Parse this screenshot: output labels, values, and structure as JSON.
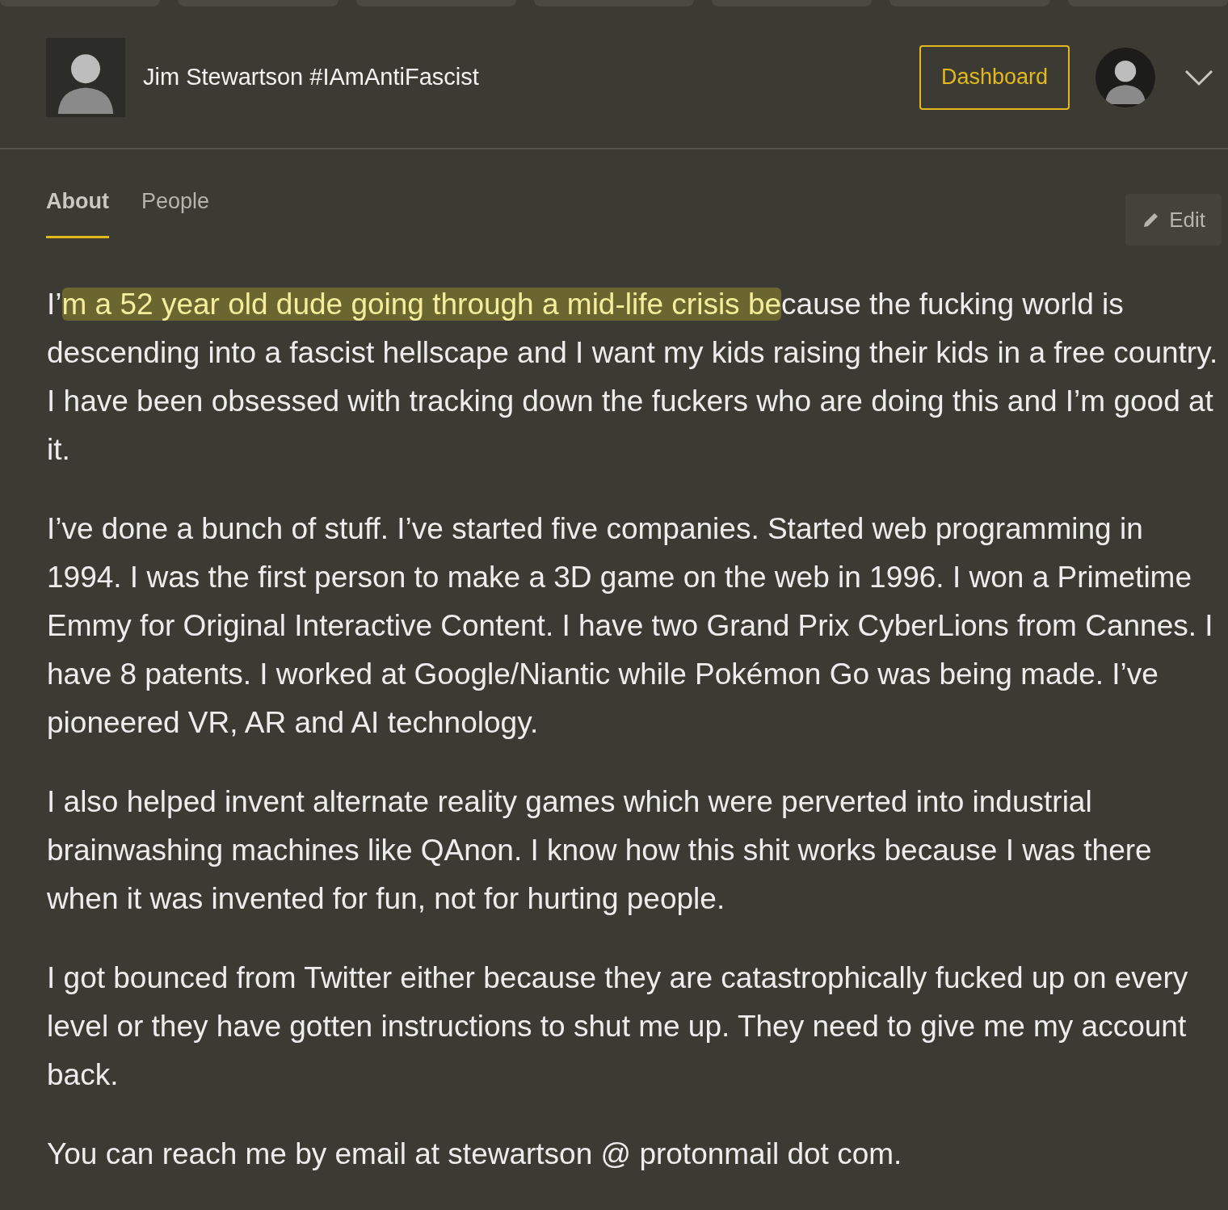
{
  "header": {
    "name": "Jim Stewartson #IAmAntiFascist",
    "button": "Dashboard"
  },
  "tabs": [
    {
      "label": "About",
      "selected": true
    },
    {
      "label": "People",
      "selected": false
    }
  ],
  "edit_button": "Edit",
  "paragraphs": [
    {
      "segments": [
        {
          "text": "I’",
          "highlighted": false
        },
        {
          "text": "m a 52 year old dude going through a mid-life crisis be",
          "highlighted": true
        },
        {
          "text": "cause the fucking world is descending into a fascist hellscape and I want my kids raising their kids in a free country. I have been obsessed with tracking down the fuckers who are doing this and I’m good at it.",
          "highlighted": false
        }
      ]
    },
    {
      "segments": [
        {
          "text": "I’ve done a bunch of stuff. I’ve started five companies. Started web programming in 1994. I was the first person to make a 3D game on the web in 1996. I won a Primetime Emmy for Original Interactive Content. I have two Grand Prix CyberLions from Cannes. I have 8 patents. I worked at Google/Niantic while Pokémon Go was being made. I’ve pioneered VR, AR and AI technology.",
          "highlighted": false
        }
      ]
    },
    {
      "segments": [
        {
          "text": "I also helped invent alternate reality games which were perverted into industrial brainwashing machines like QAnon. I know how this shit works because I was there when it was invented for fun, not for hurting people.",
          "highlighted": false
        }
      ]
    },
    {
      "segments": [
        {
          "text": "I got bounced from Twitter either because they are catastrophically fucked up on every level or they have gotten instructions to shut me up. They need to give me my account back.",
          "highlighted": false
        }
      ]
    },
    {
      "segments": [
        {
          "text": "You can reach me by email at stewartson @ protonmail dot com.",
          "highlighted": false
        }
      ]
    }
  ]
}
